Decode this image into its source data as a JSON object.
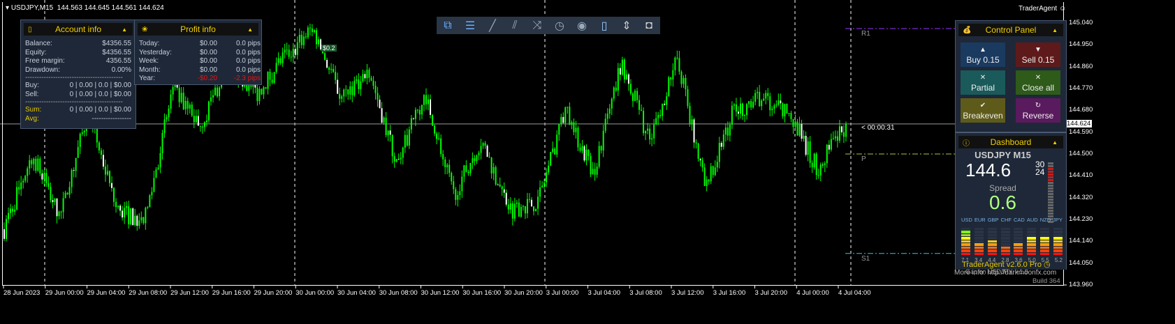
{
  "chart_header": {
    "symbol": "USDJPY,M15",
    "ohlc": "144.563 144.645 144.561 144.624"
  },
  "brand": "TraderAgent",
  "chart_data": {
    "type": "candlestick",
    "y_ticks": [
      "145.040",
      "144.950",
      "144.860",
      "144.770",
      "144.680",
      "144.590",
      "144.500",
      "144.410",
      "144.320",
      "144.230",
      "144.140",
      "144.050",
      "143.960"
    ],
    "ylim": [
      143.96,
      145.04
    ],
    "current_price": "144.624",
    "x_ticks": [
      "28 Jun 2023",
      "29 Jun 00:00",
      "29 Jun 04:00",
      "29 Jun 08:00",
      "29 Jun 12:00",
      "29 Jun 16:00",
      "29 Jun 20:00",
      "30 Jun 00:00",
      "30 Jun 04:00",
      "30 Jun 08:00",
      "30 Jun 12:00",
      "30 Jun 16:00",
      "30 Jun 20:00",
      "3 Jul 00:00",
      "3 Jul 04:00",
      "3 Jul 08:00",
      "3 Jul 12:00",
      "3 Jul 16:00",
      "3 Jul 20:00",
      "4 Jul 00:00",
      "4 Jul 04:00"
    ],
    "close_path": [
      144.19,
      144.5,
      144.24,
      144.68,
      144.27,
      144.22,
      144.76,
      144.62,
      144.88,
      144.75,
      144.9,
      145.02,
      144.73,
      144.85,
      144.45,
      144.76,
      144.33,
      144.56,
      144.27,
      144.3,
      144.68,
      144.42,
      144.88,
      144.55,
      144.9,
      144.35,
      144.68,
      144.73,
      144.66,
      144.44,
      144.624
    ],
    "bull_color": "#00ff00",
    "bear_color": "#ffffff",
    "levels": [
      {
        "name": "R1",
        "price": 145.017,
        "color": "#9933ff"
      },
      {
        "name": "P",
        "price": 144.5,
        "color": "#b8c040"
      },
      {
        "name": "S1",
        "price": 144.09,
        "color": "#20d0e0"
      }
    ],
    "timer": "< 00:00:31",
    "trade_label": "$0.2"
  },
  "toolbar": [
    "windows-icon",
    "menu-icon",
    "trendline-icon",
    "channel-icon",
    "shuffle-icon",
    "clock-icon",
    "eye-icon",
    "trash-icon",
    "resize-icon",
    "camera-icon"
  ],
  "account": {
    "title": "Account info",
    "rows": [
      [
        "Balance:",
        "$4356.55"
      ],
      [
        "Equity:",
        "$4356.55"
      ],
      [
        "Free margin:",
        "4356.55"
      ],
      [
        "Drawdown:",
        "0.00%"
      ]
    ],
    "sep": "------------------------------------------",
    "buy": [
      "Buy:",
      "0 | 0.00 | 0.0 | $0.00"
    ],
    "sell": [
      "Sell:",
      "0 | 0.00 | 0.0 | $0.00"
    ],
    "sum": [
      "Sum:",
      "0 | 0.00 | 0.0 | $0.00"
    ],
    "avg": [
      "Avg:",
      "-----------------"
    ]
  },
  "profit": {
    "title": "Profit info",
    "rows": [
      [
        "Today:",
        "$0.00",
        "0.0 pips"
      ],
      [
        "Yesterday:",
        "$0.00",
        "0.0 pips"
      ],
      [
        "Week:",
        "$0.00",
        "0.0 pips"
      ],
      [
        "Month:",
        "$0.00",
        "0.0 pips"
      ],
      [
        "Year:",
        "-$0.20",
        "-2.3 pips"
      ]
    ]
  },
  "control": {
    "title": "Control Panel",
    "buttons": [
      {
        "icon": "▲",
        "label": "Buy 0.15",
        "color": "#1a3a60"
      },
      {
        "icon": "▼",
        "label": "Sell 0.15",
        "color": "#5e1a1a"
      },
      {
        "icon": "✕",
        "label": "Partial",
        "color": "#1a5a5a"
      },
      {
        "icon": "✕",
        "label": "Close all",
        "color": "#2e5a1a"
      },
      {
        "icon": "✔",
        "label": "Breakeven",
        "color": "#5e5a1a"
      },
      {
        "icon": "↻",
        "label": "Reverse",
        "color": "#5a1a5e"
      }
    ]
  },
  "dashboard": {
    "title": "Dashboard",
    "symbol": "USDJPY M15",
    "price_main": "144.6",
    "price_bid": "30",
    "price_ask": "24",
    "spread_label": "Spread",
    "spread": "0.6",
    "currencies": [
      "USD",
      "EUR",
      "GBP",
      "CHF",
      "CAD",
      "AUD",
      "NZD",
      "JPY"
    ],
    "strength": [
      7.1,
      3.4,
      4.4,
      2.8,
      3.6,
      5.0,
      5.5,
      5.2
    ],
    "strength_labels": [
      "7.1",
      "3.4",
      "4.4",
      "2.8",
      "3.6",
      "5.0",
      "5.5",
      "5.2"
    ],
    "gap": "Gap on USDJPY: +1.9",
    "version": "TraderAgent v2.6.0 Pro",
    "info": "More info: http://darkmoonfx.com",
    "build": "Build 364"
  }
}
